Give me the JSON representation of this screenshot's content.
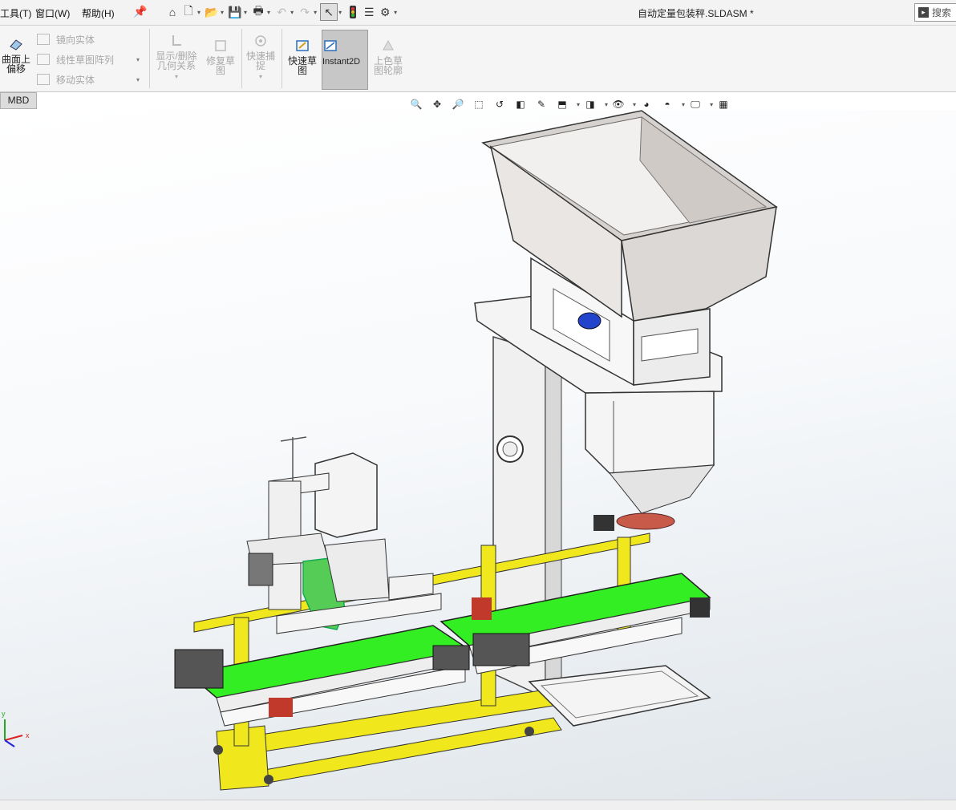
{
  "menu": {
    "tools": "工具(T)",
    "window": "窗口(W)",
    "help": "帮助(H)"
  },
  "document_title": "自动定量包装秤.SLDASM *",
  "search": {
    "placeholder": "搜索"
  },
  "ribbon": {
    "offset_surface": "曲面上偏移",
    "mirror_entities": "镜向实体",
    "linear_pattern": "线性草图阵列",
    "move_entities": "移动实体",
    "display_delete_relations": "显示/删除几何关系",
    "repair_sketch": "修复草图",
    "quick_snaps": "快速捕捉",
    "rapid_sketch": "快速草图",
    "instant2d": "Instant2D",
    "shaded_sketch_contours": "上色草图轮廓"
  },
  "tabs": {
    "mbd": "MBD"
  },
  "triad": {
    "x": "x",
    "y": "y"
  },
  "colors": {
    "conveyor_belt": "#33ee22",
    "frame": "#f0e81c",
    "hopper": "#e8e4e0",
    "motor_green": "#55cc55",
    "motor_blue": "#2244cc"
  }
}
